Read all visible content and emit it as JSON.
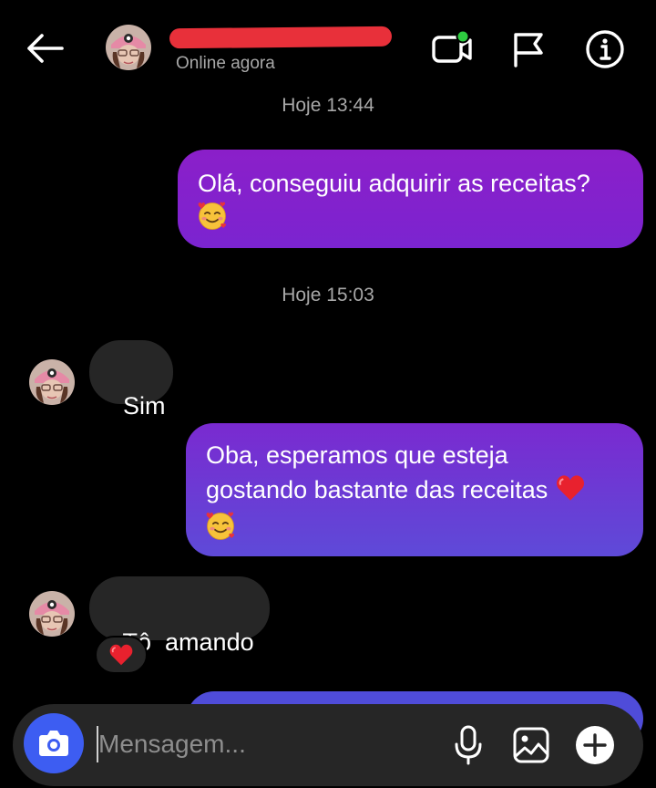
{
  "header": {
    "status": "Online agora",
    "back_icon": "arrow-left-icon",
    "video_icon": "video-call-icon",
    "flag_icon": "flag-icon",
    "info_icon": "info-icon",
    "online_dot_color": "#2ecc40"
  },
  "conversation": {
    "timestamps": [
      "Hoje 13:44",
      "Hoje 15:03"
    ],
    "messages": [
      {
        "direction": "outgoing",
        "text": "Olá, conseguiu adquirir as receitas?",
        "emoji": "smiling-face-with-hearts"
      },
      {
        "direction": "incoming",
        "text": "Sim"
      },
      {
        "direction": "outgoing",
        "line1": "Oba, esperamos que esteja",
        "line2": "gostando bastante das receitas",
        "emoji_inline": "red-heart",
        "emoji": "smiling-face-with-hearts"
      },
      {
        "direction": "incoming",
        "text": "Tô  amando",
        "reaction": "red-heart"
      }
    ]
  },
  "composer": {
    "placeholder": "Mensagem...",
    "camera_icon": "camera-icon",
    "mic_icon": "microphone-icon",
    "gallery_icon": "image-gallery-icon",
    "add_icon": "plus-circle-icon"
  },
  "colors": {
    "background": "#000000",
    "incoming_bubble": "#262626",
    "outgoing_gradient_top": "#8b1fc9",
    "outgoing_gradient_bottom": "#5a4bd9",
    "camera_button": "#3d5df2",
    "secondary_text": "#a8a8a8"
  }
}
